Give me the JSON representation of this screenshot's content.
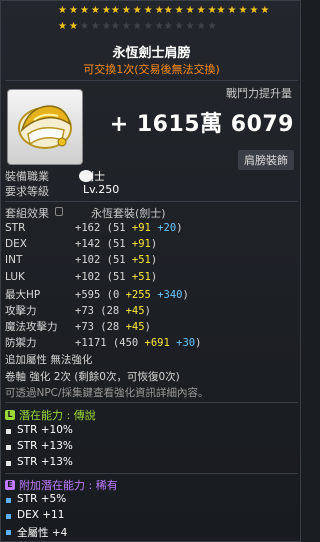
{
  "stars": {
    "row1": [
      [
        1,
        1,
        1,
        1,
        1
      ],
      [
        1,
        1,
        1,
        1,
        1
      ],
      [
        1,
        1,
        1,
        1,
        1
      ],
      [
        1,
        1,
        1,
        1,
        1
      ]
    ],
    "row2": [
      [
        1,
        1,
        0,
        0,
        0
      ],
      [
        0,
        0,
        0,
        0,
        0
      ],
      [
        0,
        0,
        0,
        0,
        0
      ]
    ],
    "on_color": "#f2c21c"
  },
  "item": {
    "name": "永恆劍士肩膀",
    "trade_note": "可交換1次(交易後無法交換)"
  },
  "combat_power": {
    "label": "戰鬥力提升量",
    "value": "+ 1615萬 6079"
  },
  "category_badge": "肩膀裝飾",
  "job": {
    "label": "裝備職業",
    "value": "劍士"
  },
  "level": {
    "label": "要求等級",
    "value": "Lv.250"
  },
  "set_effect": {
    "label": "套組效果",
    "value": "永恆套裝(劍士)"
  },
  "stats": [
    {
      "name": "STR",
      "total": "+162",
      "base": "(51",
      "scroll": "+91",
      "flame": "+20",
      "close": ")"
    },
    {
      "name": "DEX",
      "total": "+142",
      "base": "(51",
      "scroll": "+91",
      "flame": "",
      "close": ")"
    },
    {
      "name": "INT",
      "total": "+102",
      "base": "(51",
      "scroll": "+51",
      "flame": "",
      "close": ")"
    },
    {
      "name": "LUK",
      "total": "+102",
      "base": "(51",
      "scroll": "+51",
      "flame": "",
      "close": ")"
    },
    {
      "name": "最大HP",
      "total": "+595",
      "base": "(0",
      "scroll": "+255",
      "flame": "+340",
      "close": ")"
    },
    {
      "name": "攻擊力",
      "total": "+73",
      "base": "(28",
      "scroll": "+45",
      "flame": "",
      "close": ")"
    },
    {
      "name": "魔法攻擊力",
      "total": "+73",
      "base": "(28",
      "scroll": "+45",
      "flame": "",
      "close": ")"
    },
    {
      "name": "防禦力",
      "total": "+1171",
      "base": "(450",
      "scroll": "+691",
      "flame": "+30",
      "close": ")"
    }
  ],
  "extra_attr": {
    "label": "追加屬性",
    "value": "無法強化"
  },
  "scroll": {
    "label": "卷軸 強化",
    "value": "2次 (剩餘0次，可恢復0次)"
  },
  "npc_note": "可透過NPC/採集鍵查看強化資訊詳細內容。",
  "potential": {
    "label": "潛在能力 : 傳說",
    "icon": "L",
    "color": "#9bd93a",
    "lines": [
      "STR +10%",
      "STR +13%",
      "STR +13%"
    ]
  },
  "additional_potential": {
    "label": "附加潛在能力 : 稀有",
    "icon": "E",
    "color": "#c07aff",
    "bullet_color": "#5ab0ff",
    "lines": [
      "STR +5%",
      "DEX +11",
      "全屬性 +4"
    ]
  }
}
